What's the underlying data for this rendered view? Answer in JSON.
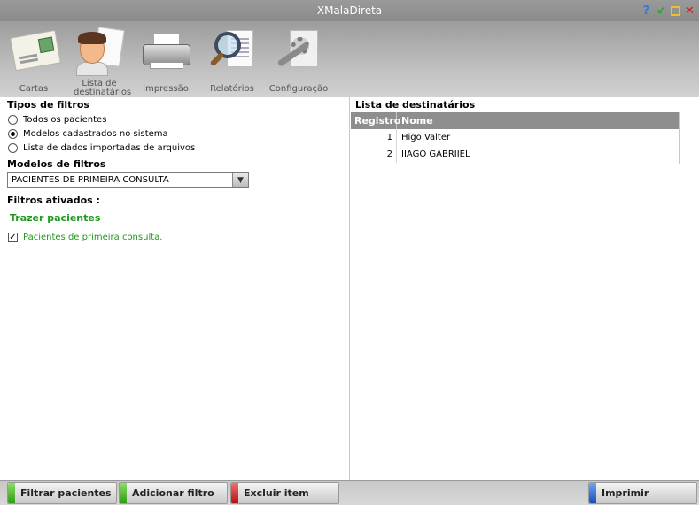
{
  "window": {
    "title": "XMalaDireta",
    "controls": [
      "help-icon",
      "minimize-icon",
      "maximize-icon",
      "close-icon"
    ]
  },
  "toolbar": {
    "items": [
      {
        "label": "Cartas",
        "icon": "envelope-icon"
      },
      {
        "label": "Lista de destinatários",
        "icon": "contact-list-icon"
      },
      {
        "label": "Impressão",
        "icon": "printer-icon"
      },
      {
        "label": "Relatórios",
        "icon": "magnifier-icon"
      },
      {
        "label": "Configuração",
        "icon": "settings-tools-icon"
      }
    ]
  },
  "filters": {
    "types_title": "Tipos de filtros",
    "options": [
      {
        "label": "Todos os pacientes",
        "selected": false
      },
      {
        "label": "Modelos cadastrados no sistema",
        "selected": true
      },
      {
        "label": "Lista de dados importadas de arquivos",
        "selected": false
      }
    ],
    "models_title": "Modelos de filtros",
    "selected_model": "PACIENTES DE PRIMEIRA CONSULTA",
    "active_title": "Filtros ativados :",
    "action_title": "Trazer pacientes",
    "active_items": [
      {
        "label": "Pacientes de primeira consulta.",
        "checked": true
      }
    ]
  },
  "recipients": {
    "title": "Lista de destinatários",
    "columns": [
      "Registro",
      "Nome"
    ],
    "rows": [
      {
        "registro": "1",
        "nome": "Higo Valter"
      },
      {
        "registro": "2",
        "nome": "IIAGO GABRIIEL"
      }
    ]
  },
  "footer": {
    "filter_button": "Filtrar pacientes",
    "add_filter_button": "Adicionar filtro",
    "delete_button": "Excluir item",
    "print_button": "Imprimir"
  },
  "colors": {
    "accent_green": "#1f9a1f",
    "grid_header": "#8e8e8e",
    "titlebar": "#9a9a9a"
  }
}
